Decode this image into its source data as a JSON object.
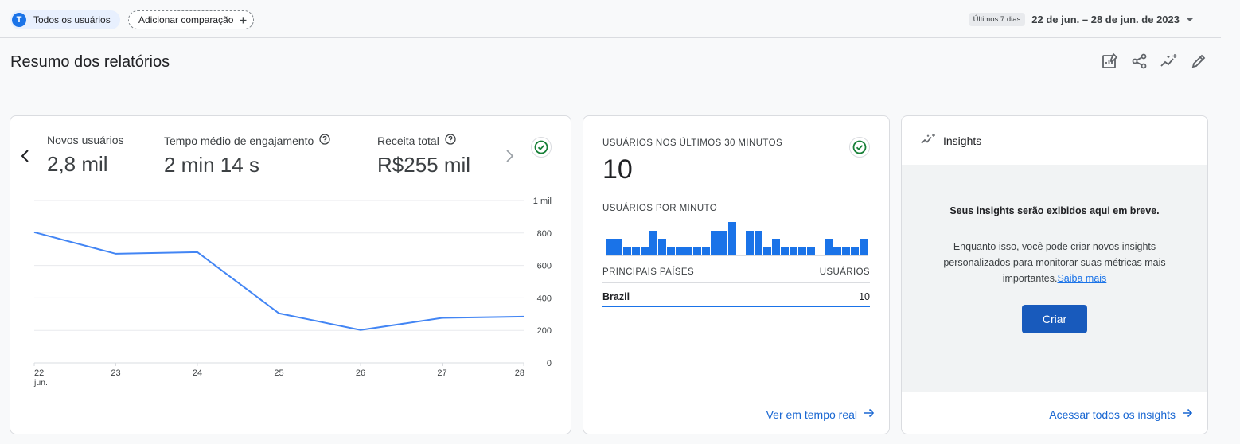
{
  "header": {
    "segment_avatar": "T",
    "segment_label": "Todos os usuários",
    "compare_label": "Adicionar comparação",
    "date_badge": "Últimos 7 dias",
    "date_range": "22 de jun. – 28 de jun. de 2023"
  },
  "page": {
    "title": "Resumo dos relatórios",
    "toolbar_icons": [
      "customize-report-icon",
      "share-icon",
      "insights-icon",
      "edit-icon"
    ]
  },
  "overview_card": {
    "metrics": [
      {
        "label": "Novos usuários",
        "value": "2,8 mil",
        "has_help": false
      },
      {
        "label": "Tempo médio de engajamento",
        "value": "2 min 14 s",
        "has_help": true
      },
      {
        "label": "Receita total",
        "value": "R$255 mil",
        "has_help": true
      }
    ]
  },
  "chart_data": {
    "type": "line",
    "x": [
      "22",
      "23",
      "24",
      "25",
      "26",
      "27",
      "28"
    ],
    "x_sublabel_first": "jun.",
    "series": [
      {
        "values": [
          805,
          672,
          682,
          305,
          202,
          277,
          285
        ],
        "color": "#4285f4"
      }
    ],
    "ylim": [
      0,
      1000
    ],
    "yticks": [
      0,
      200,
      400,
      600,
      800,
      1000
    ],
    "ytick_labels": [
      "0",
      "200",
      "400",
      "600",
      "800",
      "1 mil"
    ],
    "y_axis_side": "right",
    "grid": true
  },
  "realtime_card": {
    "title": "USUÁRIOS NOS ÚLTIMOS 30 MINUTOS",
    "value": "10",
    "per_minute_label": "USUÁRIOS POR MINUTO",
    "per_minute_values": [
      2,
      2,
      1,
      1,
      1,
      3,
      2,
      1,
      1,
      1,
      1,
      1,
      3,
      3,
      4,
      0,
      3,
      3,
      1,
      2,
      1,
      1,
      1,
      1,
      0,
      2,
      1,
      1,
      1,
      2
    ],
    "table_headers": [
      "PRINCIPAIS PAÍSES",
      "USUÁRIOS"
    ],
    "rows": [
      {
        "country": "Brazil",
        "users": "10"
      }
    ],
    "link": "Ver em tempo real"
  },
  "insights_card": {
    "title": "Insights",
    "heading": "Seus insights serão exibidos aqui em breve.",
    "body": "Enquanto isso, você pode criar novos insights personalizados para monitorar suas métricas mais importantes.",
    "learn_more": "Saiba mais",
    "button": "Criar",
    "link": "Acessar todos os insights"
  },
  "colors": {
    "accent": "#1a73e8",
    "bar": "#1a73e8",
    "line": "#4285f4",
    "success": "#188038"
  }
}
